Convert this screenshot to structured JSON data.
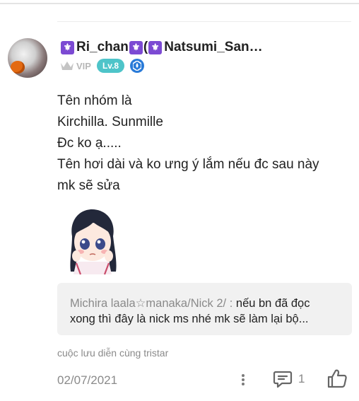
{
  "comment": {
    "username": "Ri_chan",
    "username_suffix": "(",
    "username_second": "Natsumi_San…",
    "vip_label": "VIP",
    "level_label": "Lv.8",
    "message_lines": [
      "Tên nhóm là",
      "Kirchilla. Sunmille",
      "Đc ko ạ.....",
      "Tên hơi dài và ko ưng ý lắm nếu đc sau này",
      "mk sẽ sửa"
    ],
    "quote": {
      "author": "Michira laala☆manaka/Nick 2/ :",
      "text_line1": "nếu bn đã đọc",
      "text_line2": "xong thì đây là nick ms nhé mk sẽ làm lại bộ..."
    },
    "props_caption": "cuộc lưu diễn cùng tristar",
    "date": "02/07/2021",
    "reply_count": "1"
  },
  "icons": {
    "fleur": "fleur-de-lis-icon",
    "crown": "crown-icon",
    "curator": "curator-badge-icon",
    "more": "more-vertical-icon",
    "comment": "comment-icon",
    "like": "thumbs-up-icon"
  },
  "colors": {
    "fleur_badge": "#7c4ad3",
    "level_badge": "#4ec4c9",
    "curator_badge": "#2a7bd8",
    "muted_text": "#8a8a8a",
    "quote_bg": "#f1f1f1"
  }
}
